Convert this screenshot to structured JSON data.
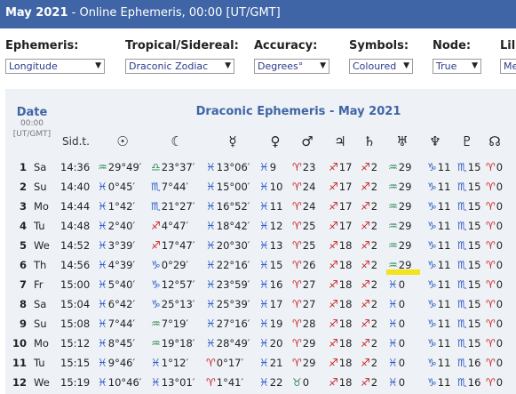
{
  "header": {
    "title_bold": "May 2021",
    "title_rest": " - Online Ephemeris, 00:00 [UT/GMT]"
  },
  "controls": {
    "ephemeris": {
      "label": "Ephemeris:",
      "value": "Longitude"
    },
    "zodiac": {
      "label": "Tropical/Sidereal:",
      "value": "Draconic Zodiac"
    },
    "accuracy": {
      "label": "Accuracy:",
      "value": "Degrees°"
    },
    "symbols": {
      "label": "Symbols:",
      "value": "Coloured"
    },
    "node": {
      "label": "Node:",
      "value": "True"
    },
    "lilith": {
      "label": "Lil",
      "value": "Me"
    }
  },
  "table": {
    "date_header": "Date",
    "time_header": "00:00",
    "zone_header": "[UT/GMT]",
    "title": "Draconic Ephemeris - May 2021",
    "sid_header": "Sid.t.",
    "planet_icons": [
      "sun-icon",
      "moon-icon",
      "mercury-icon",
      "venus-icon",
      "mars-icon",
      "jupiter-icon",
      "saturn-icon",
      "uranus-icon",
      "neptune-icon",
      "pluto-icon",
      "node-icon"
    ],
    "planet_glyphs": [
      "☉",
      "☾",
      "☿",
      "♀",
      "♂",
      "♃",
      "♄",
      "♅",
      "♆",
      "♇",
      "☊"
    ],
    "rows": [
      {
        "day": "1",
        "wd": "Sa",
        "sid": "14:36",
        "cells": [
          [
            "♒",
            "aq",
            "29°49′"
          ],
          [
            "♎",
            "li",
            "23°37′"
          ],
          [
            "♓",
            "pi",
            "13°06′"
          ],
          [
            "♓",
            "pi",
            "9"
          ],
          [
            "♈",
            "ar",
            "23"
          ],
          [
            "♐",
            "sg",
            "17"
          ],
          [
            "♐",
            "sg",
            "2"
          ],
          [
            "♒",
            "aq",
            "29"
          ],
          [
            "♑",
            "cp",
            "11"
          ],
          [
            "♏",
            "sc",
            "15"
          ],
          [
            "♈",
            "ar",
            "0"
          ]
        ]
      },
      {
        "day": "2",
        "wd": "Su",
        "sid": "14:40",
        "cells": [
          [
            "♓",
            "pi",
            "0°45′"
          ],
          [
            "♏",
            "sc",
            "7°44′"
          ],
          [
            "♓",
            "pi",
            "15°00′"
          ],
          [
            "♓",
            "pi",
            "10"
          ],
          [
            "♈",
            "ar",
            "24"
          ],
          [
            "♐",
            "sg",
            "17"
          ],
          [
            "♐",
            "sg",
            "2"
          ],
          [
            "♒",
            "aq",
            "29"
          ],
          [
            "♑",
            "cp",
            "11"
          ],
          [
            "♏",
            "sc",
            "15"
          ],
          [
            "♈",
            "ar",
            "0"
          ]
        ]
      },
      {
        "day": "3",
        "wd": "Mo",
        "sid": "14:44",
        "cells": [
          [
            "♓",
            "pi",
            "1°42′"
          ],
          [
            "♏",
            "sc",
            "21°27′"
          ],
          [
            "♓",
            "pi",
            "16°52′"
          ],
          [
            "♓",
            "pi",
            "11"
          ],
          [
            "♈",
            "ar",
            "24"
          ],
          [
            "♐",
            "sg",
            "17"
          ],
          [
            "♐",
            "sg",
            "2"
          ],
          [
            "♒",
            "aq",
            "29"
          ],
          [
            "♑",
            "cp",
            "11"
          ],
          [
            "♏",
            "sc",
            "15"
          ],
          [
            "♈",
            "ar",
            "0"
          ]
        ]
      },
      {
        "day": "4",
        "wd": "Tu",
        "sid": "14:48",
        "cells": [
          [
            "♓",
            "pi",
            "2°40′"
          ],
          [
            "♐",
            "sg",
            "4°47′"
          ],
          [
            "♓",
            "pi",
            "18°42′"
          ],
          [
            "♓",
            "pi",
            "12"
          ],
          [
            "♈",
            "ar",
            "25"
          ],
          [
            "♐",
            "sg",
            "17"
          ],
          [
            "♐",
            "sg",
            "2"
          ],
          [
            "♒",
            "aq",
            "29"
          ],
          [
            "♑",
            "cp",
            "11"
          ],
          [
            "♏",
            "sc",
            "15"
          ],
          [
            "♈",
            "ar",
            "0"
          ]
        ]
      },
      {
        "day": "5",
        "wd": "We",
        "sid": "14:52",
        "cells": [
          [
            "♓",
            "pi",
            "3°39′"
          ],
          [
            "♐",
            "sg",
            "17°47′"
          ],
          [
            "♓",
            "pi",
            "20°30′"
          ],
          [
            "♓",
            "pi",
            "13"
          ],
          [
            "♈",
            "ar",
            "25"
          ],
          [
            "♐",
            "sg",
            "18"
          ],
          [
            "♐",
            "sg",
            "2"
          ],
          [
            "♒",
            "aq",
            "29"
          ],
          [
            "♑",
            "cp",
            "11"
          ],
          [
            "♏",
            "sc",
            "15"
          ],
          [
            "♈",
            "ar",
            "0"
          ]
        ]
      },
      {
        "day": "6",
        "wd": "Th",
        "sid": "14:56",
        "cells": [
          [
            "♓",
            "pi",
            "4°39′"
          ],
          [
            "♑",
            "cp",
            "0°29′"
          ],
          [
            "♓",
            "pi",
            "22°16′"
          ],
          [
            "♓",
            "pi",
            "15"
          ],
          [
            "♈",
            "ar",
            "26"
          ],
          [
            "♐",
            "sg",
            "18"
          ],
          [
            "♐",
            "sg",
            "2"
          ],
          [
            "♒",
            "aq",
            "29"
          ],
          [
            "♑",
            "cp",
            "11"
          ],
          [
            "♏",
            "sc",
            "15"
          ],
          [
            "♈",
            "ar",
            "0"
          ]
        ]
      },
      {
        "day": "7",
        "wd": "Fr",
        "sid": "15:00",
        "cells": [
          [
            "♓",
            "pi",
            "5°40′"
          ],
          [
            "♑",
            "cp",
            "12°57′"
          ],
          [
            "♓",
            "pi",
            "23°59′"
          ],
          [
            "♓",
            "pi",
            "16"
          ],
          [
            "♈",
            "ar",
            "27"
          ],
          [
            "♐",
            "sg",
            "18"
          ],
          [
            "♐",
            "sg",
            "2"
          ],
          [
            "♓",
            "pi",
            "0"
          ],
          [
            "♑",
            "cp",
            "11"
          ],
          [
            "♏",
            "sc",
            "15"
          ],
          [
            "♈",
            "ar",
            "0"
          ]
        ]
      },
      {
        "day": "8",
        "wd": "Sa",
        "sid": "15:04",
        "cells": [
          [
            "♓",
            "pi",
            "6°42′"
          ],
          [
            "♑",
            "cp",
            "25°13′"
          ],
          [
            "♓",
            "pi",
            "25°39′"
          ],
          [
            "♓",
            "pi",
            "17"
          ],
          [
            "♈",
            "ar",
            "27"
          ],
          [
            "♐",
            "sg",
            "18"
          ],
          [
            "♐",
            "sg",
            "2"
          ],
          [
            "♓",
            "pi",
            "0"
          ],
          [
            "♑",
            "cp",
            "11"
          ],
          [
            "♏",
            "sc",
            "15"
          ],
          [
            "♈",
            "ar",
            "0"
          ]
        ]
      },
      {
        "day": "9",
        "wd": "Su",
        "sid": "15:08",
        "cells": [
          [
            "♓",
            "pi",
            "7°44′"
          ],
          [
            "♒",
            "aq",
            "7°19′"
          ],
          [
            "♓",
            "pi",
            "27°16′"
          ],
          [
            "♓",
            "pi",
            "19"
          ],
          [
            "♈",
            "ar",
            "28"
          ],
          [
            "♐",
            "sg",
            "18"
          ],
          [
            "♐",
            "sg",
            "2"
          ],
          [
            "♓",
            "pi",
            "0"
          ],
          [
            "♑",
            "cp",
            "11"
          ],
          [
            "♏",
            "sc",
            "15"
          ],
          [
            "♈",
            "ar",
            "0"
          ]
        ]
      },
      {
        "day": "10",
        "wd": "Mo",
        "sid": "15:12",
        "cells": [
          [
            "♓",
            "pi",
            "8°45′"
          ],
          [
            "♒",
            "aq",
            "19°18′"
          ],
          [
            "♓",
            "pi",
            "28°49′"
          ],
          [
            "♓",
            "pi",
            "20"
          ],
          [
            "♈",
            "ar",
            "29"
          ],
          [
            "♐",
            "sg",
            "18"
          ],
          [
            "♐",
            "sg",
            "2"
          ],
          [
            "♓",
            "pi",
            "0"
          ],
          [
            "♑",
            "cp",
            "11"
          ],
          [
            "♏",
            "sc",
            "15"
          ],
          [
            "♈",
            "ar",
            "0"
          ]
        ]
      },
      {
        "day": "11",
        "wd": "Tu",
        "sid": "15:15",
        "cells": [
          [
            "♓",
            "pi",
            "9°46′"
          ],
          [
            "♓",
            "pi",
            "1°12′"
          ],
          [
            "♈",
            "ar",
            "0°17′"
          ],
          [
            "♓",
            "pi",
            "21"
          ],
          [
            "♈",
            "ar",
            "29"
          ],
          [
            "♐",
            "sg",
            "18"
          ],
          [
            "♐",
            "sg",
            "2"
          ],
          [
            "♓",
            "pi",
            "0"
          ],
          [
            "♑",
            "cp",
            "11"
          ],
          [
            "♏",
            "sc",
            "16"
          ],
          [
            "♈",
            "ar",
            "0"
          ]
        ]
      },
      {
        "day": "12",
        "wd": "We",
        "sid": "15:19",
        "cells": [
          [
            "♓",
            "pi",
            "10°46′"
          ],
          [
            "♓",
            "pi",
            "13°01′"
          ],
          [
            "♈",
            "ar",
            "1°41′"
          ],
          [
            "♓",
            "pi",
            "22"
          ],
          [
            "♉",
            "ta",
            "0"
          ],
          [
            "♐",
            "sg",
            "18"
          ],
          [
            "♐",
            "sg",
            "2"
          ],
          [
            "♓",
            "pi",
            "0"
          ],
          [
            "♑",
            "cp",
            "11"
          ],
          [
            "♏",
            "sc",
            "16"
          ],
          [
            "♈",
            "ar",
            "0"
          ]
        ]
      }
    ]
  }
}
